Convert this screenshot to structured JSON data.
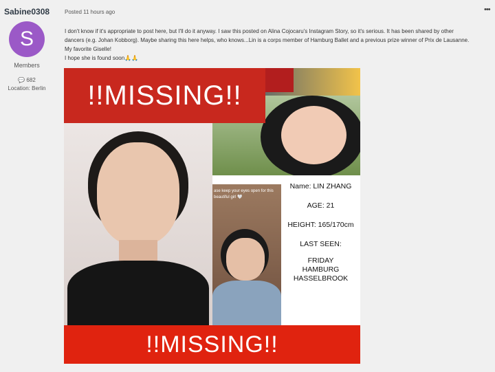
{
  "author": {
    "username": "Sabine0308",
    "avatar_letter": "S",
    "avatar_color": "#9b59c7",
    "group": "Members",
    "post_count": "682",
    "location": "Location: Berlin"
  },
  "post": {
    "posted": "Posted 11 hours ago",
    "menu_label": "•••",
    "lines": [
      "I don't know if it's appropriate to post here, but I'll do it anyway. I saw this posted on Alina Cojocaru's Instagram Story, so it's serious. It has been shared by other",
      "dancers (e.g. Johan Kobborg). Maybe sharing this here helps, who knows...Lin is a corps member of Hamburg Ballet and a previous prize winner of Prix de Lausanne.",
      "My favorite Giselle!",
      "I hope she is found soon🙏🙏"
    ]
  },
  "poster": {
    "top_banner": "!!MISSING!!",
    "bottom_banner": "!!MISSING!!",
    "photo_caption": "ase keep your eyes open for this beautiful girl 🤍",
    "name": "Name: LIN ZHANG",
    "age": "AGE: 21",
    "height": "HEIGHT: 165/170cm",
    "last_seen_label": "LAST SEEN:",
    "last_seen": [
      "FRIDAY",
      "HAMBURG",
      "HASSELBROOK"
    ],
    "banner_color": "#e0230f"
  }
}
